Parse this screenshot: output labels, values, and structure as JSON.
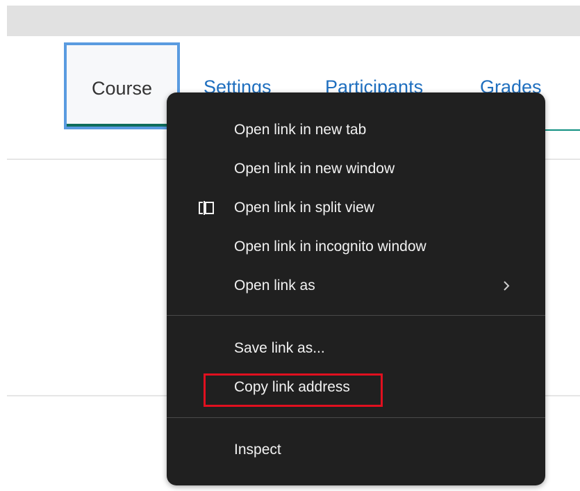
{
  "tabs": [
    {
      "label": "Course",
      "active": true
    },
    {
      "label": "Settings"
    },
    {
      "label": "Participants"
    },
    {
      "label": "Grades"
    }
  ],
  "context_menu": {
    "items": [
      {
        "label": "Open link in new tab"
      },
      {
        "label": "Open link in new window"
      },
      {
        "label": "Open link in split view",
        "icon": "split-view-icon"
      },
      {
        "label": "Open link in incognito window"
      },
      {
        "label": "Open link as",
        "submenu": true,
        "icon": "chevron-right-icon"
      },
      {
        "label": "Save link as..."
      },
      {
        "label": "Copy link address",
        "highlighted": true
      },
      {
        "label": "Inspect"
      }
    ]
  },
  "colors": {
    "menu_bg": "#202020",
    "menu_text": "#f2f2f2",
    "highlight_border": "#e0101f",
    "tab_link": "#1f6fbf",
    "active_tab_border": "#5a9be0",
    "active_tab_underline": "#0f6e5c"
  }
}
